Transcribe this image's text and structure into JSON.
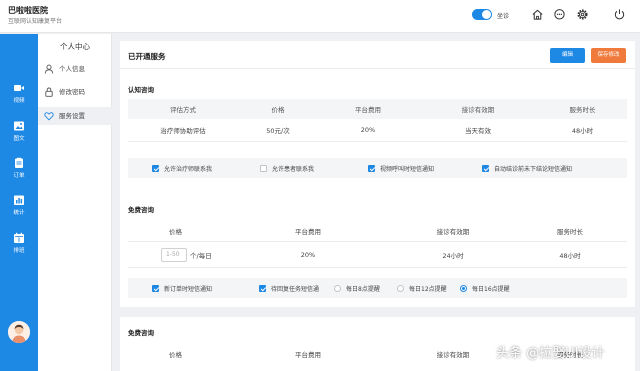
{
  "header": {
    "title": "巴啦啦医院",
    "subtitle": "互联网认知康复平台",
    "toggle_label": "坐诊",
    "toggle_on": true,
    "icons": [
      "home-icon",
      "chat-icon",
      "settings-icon",
      "power-icon"
    ]
  },
  "leftnav": {
    "items": [
      {
        "label": "视频",
        "icon": "video-icon"
      },
      {
        "label": "图文",
        "icon": "image-icon"
      },
      {
        "label": "订单",
        "icon": "order-icon"
      },
      {
        "label": "统计",
        "icon": "stats-icon"
      },
      {
        "label": "排班",
        "icon": "calendar-icon"
      }
    ],
    "accent": "#1e88e5"
  },
  "subnav": {
    "title": "个人中心",
    "items": [
      {
        "label": "个人信息",
        "icon": "person-icon"
      },
      {
        "label": "修改密码",
        "icon": "lock-icon"
      },
      {
        "label": "服务设置",
        "icon": "heart-icon",
        "active": true
      }
    ]
  },
  "main": {
    "title": "已开通服务",
    "edit_label": "编辑",
    "save_label": "保存修改",
    "cognitive": {
      "title": "认知咨询",
      "headers": [
        "评估方式",
        "价格",
        "平台费用",
        "接诊有效期",
        "服务时长"
      ],
      "row": [
        "治疗师协助评估",
        "50元/次",
        "20%",
        "当天有效",
        "48小时"
      ],
      "options": [
        {
          "label": "允许治疗师联系我",
          "checked": true
        },
        {
          "label": "允许患者联系我",
          "checked": false
        },
        {
          "label": "视频呼叫时短信通知",
          "checked": true
        },
        {
          "label": "自动结诊前未下结论短信通知",
          "checked": true
        }
      ]
    },
    "free1": {
      "title": "免费咨询",
      "headers": [
        "价格",
        "平台费用",
        "接诊有效期",
        "服务时长"
      ],
      "price_placeholder": "1-50",
      "price_unit": "个/每日",
      "row": [
        "20%",
        "24小时",
        "48小时"
      ],
      "checks": [
        {
          "label": "新订单时短信通知",
          "checked": true
        },
        {
          "label": "待回复任务短信通",
          "checked": true
        }
      ],
      "radios": [
        {
          "label": "每日8点提醒",
          "selected": false
        },
        {
          "label": "每日12点提醒",
          "selected": false
        },
        {
          "label": "每日16点提醒",
          "selected": true
        }
      ]
    },
    "free2": {
      "title": "免费咨询",
      "headers": [
        "价格",
        "平台费用",
        "接诊有效期",
        "服务时长"
      ]
    }
  },
  "watermark": "头条 @拉娶UI设计"
}
